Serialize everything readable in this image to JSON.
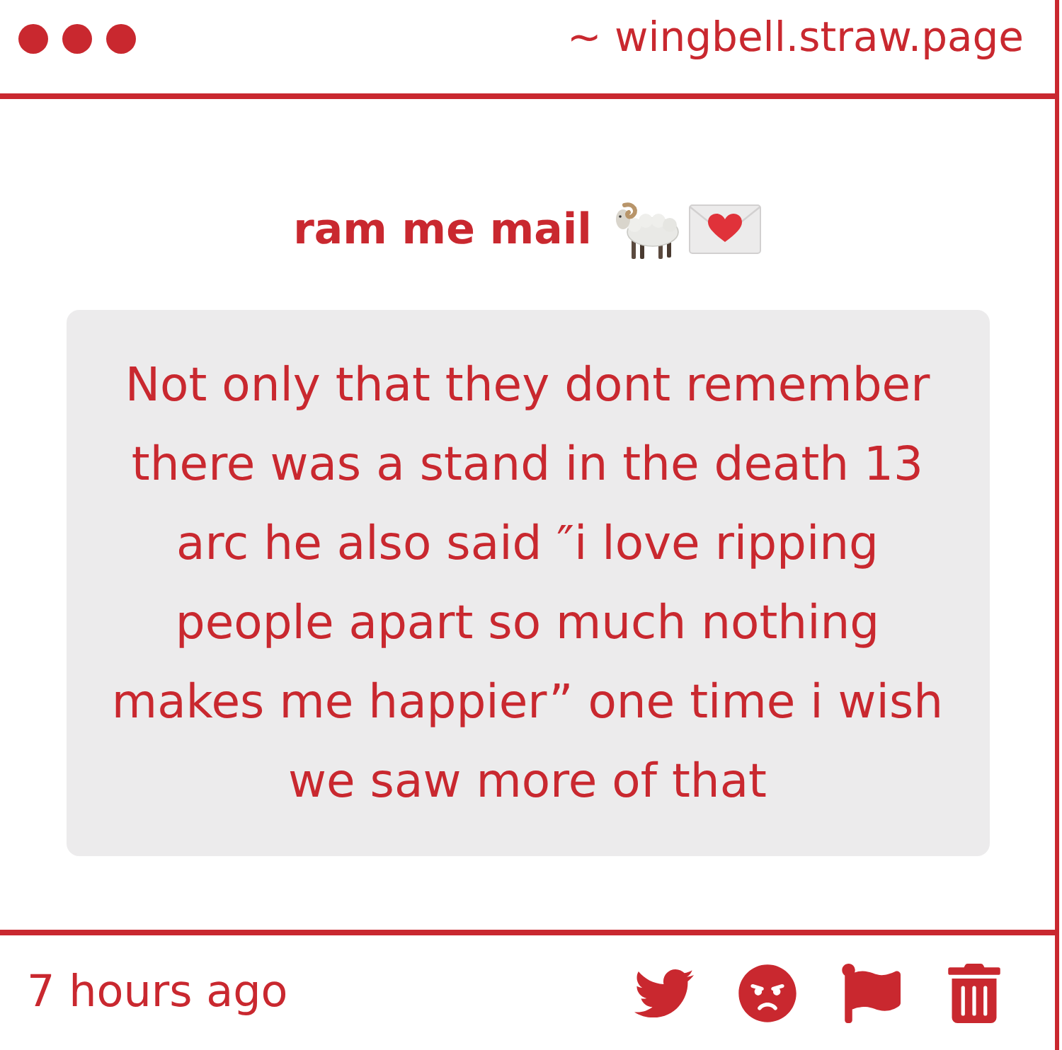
{
  "top_bar": {
    "url": "~ wingbell.straw.page"
  },
  "title": "ram me mail",
  "message": "Not only that they dont remember there was a stand in the death 13 arc he also said ″i love ripping people apart so much nothing makes me happier” one time i wish we saw more of that",
  "footer": {
    "time": "7 hours ago"
  }
}
